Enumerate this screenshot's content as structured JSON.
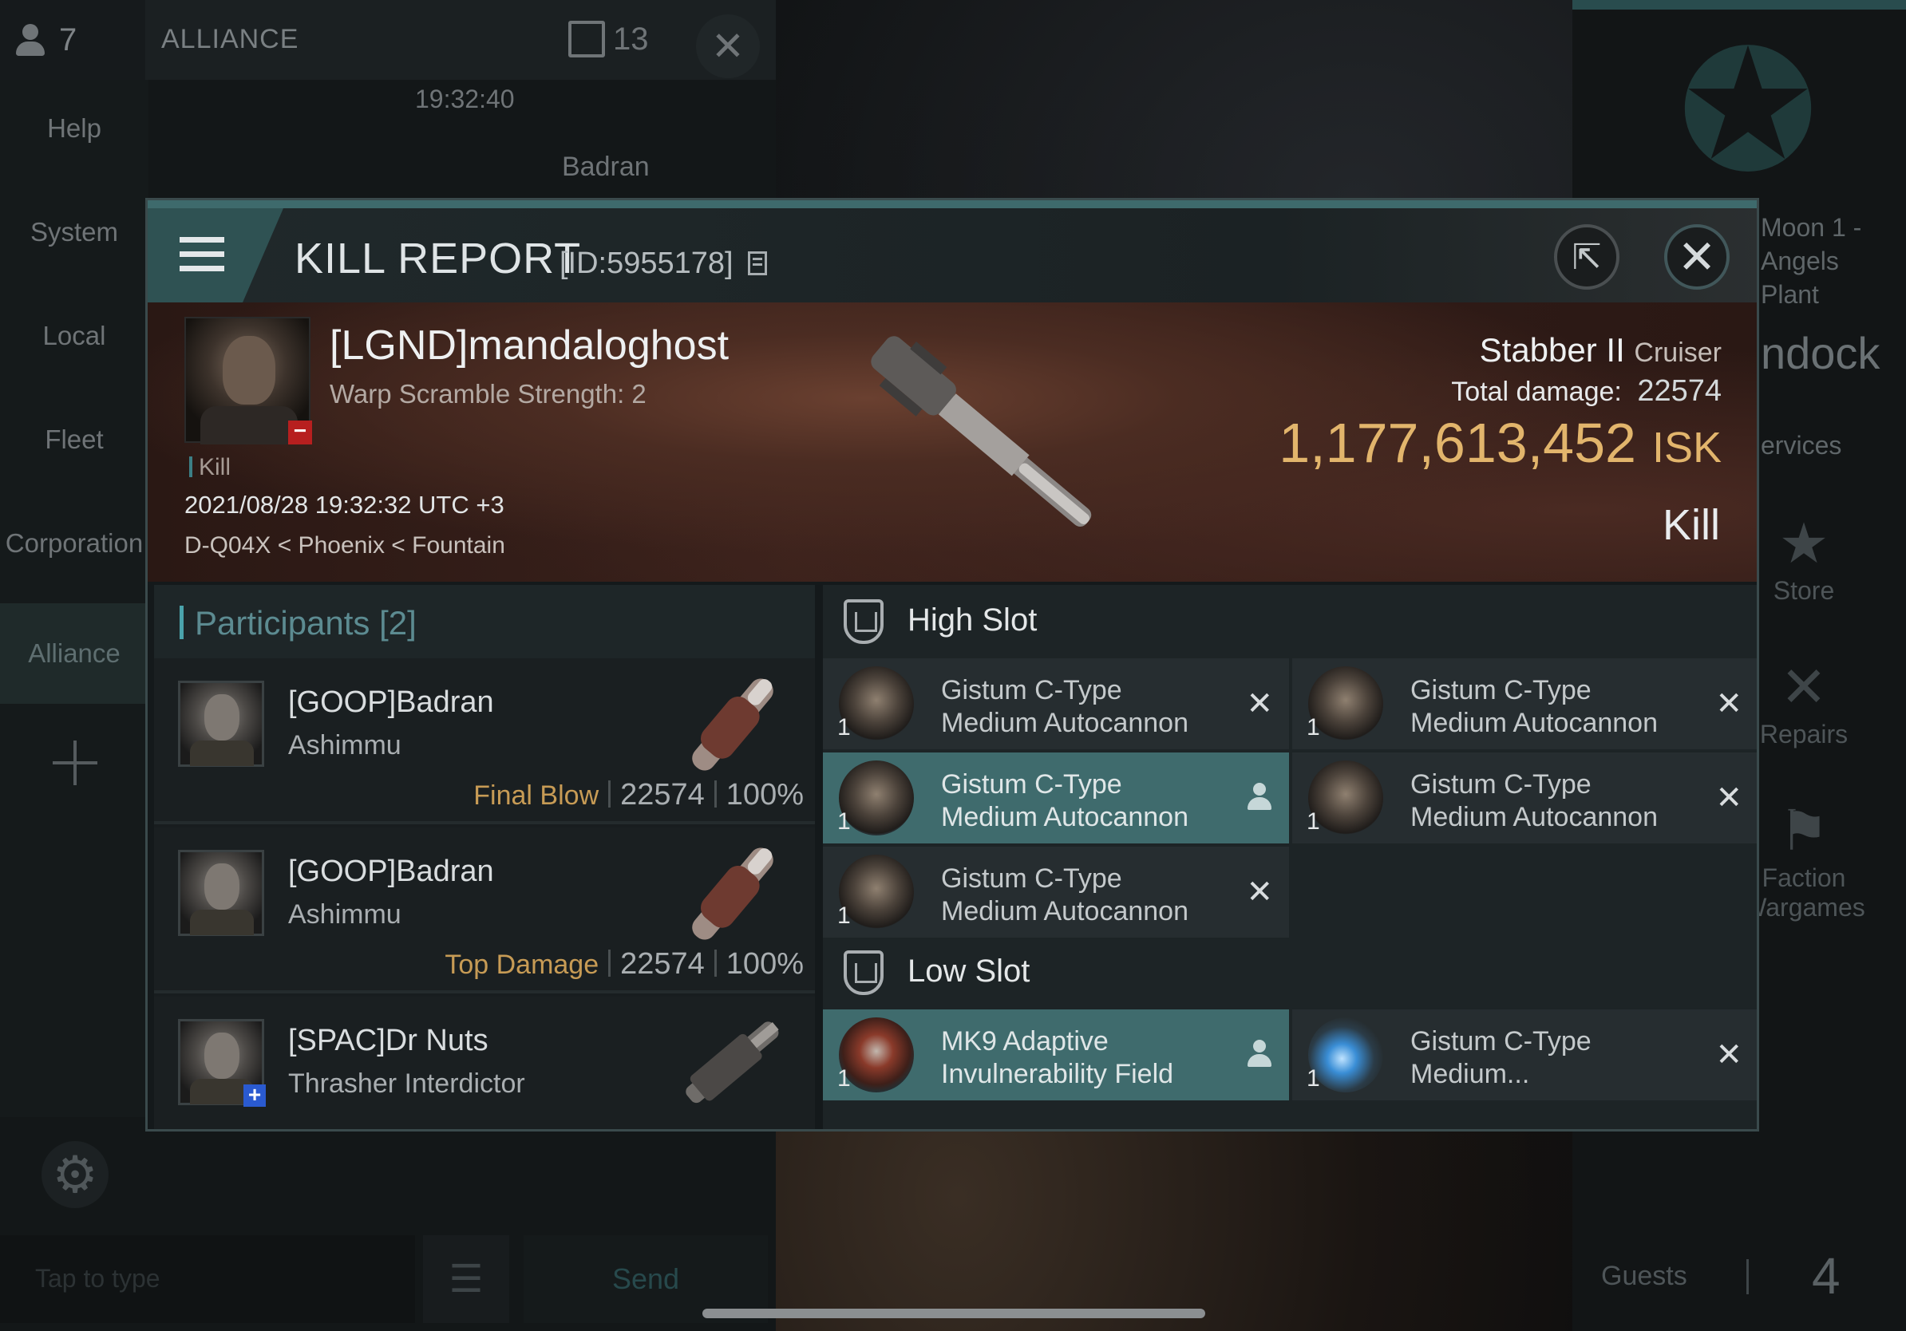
{
  "chat": {
    "member_count": "7",
    "channel": "ALLIANCE",
    "message_count": "13",
    "time": "19:32:40",
    "sender": "Badran",
    "channels": [
      "Help",
      "System",
      "Local",
      "Fleet",
      "Corporation",
      "Alliance"
    ],
    "input_placeholder": "Tap to type",
    "send_label": "Send"
  },
  "station": {
    "name_lines": [
      "Moon 1 -",
      "Angels",
      "Plant"
    ],
    "undock": "ndock",
    "services": "ervices",
    "items": [
      {
        "label": "Store",
        "icon": "nes-icon"
      },
      {
        "label": "Repairs",
        "icon": "wrench-icon"
      },
      {
        "label": "Faction Wargames",
        "icon": "flags-icon"
      }
    ],
    "guests_label": "Guests",
    "guests_count": "4"
  },
  "report": {
    "title": "KILL REPORT",
    "id": "[ID:5955178]",
    "victim": {
      "name": "[LGND]mandaloghost",
      "subtitle": "Warp Scramble Strength: 2",
      "tag": "Kill",
      "datetime": "2021/08/28 19:32:32 UTC +3",
      "location": "D-Q04X < Phoenix < Fountain"
    },
    "ship": "Stabber II",
    "ship_class": "Cruiser",
    "total_damage_label": "Total damage:",
    "total_damage": "22574",
    "isk_value": "1,177,613,452",
    "isk_unit": "ISK",
    "result": "Kill"
  },
  "participants": {
    "title": "Participants [2]",
    "rows": [
      {
        "name": "[GOOP]Badran",
        "ship": "Ashimmu",
        "tag": "Final Blow",
        "damage": "22574",
        "percent": "100%"
      },
      {
        "name": "[GOOP]Badran",
        "ship": "Ashimmu",
        "tag": "Top Damage",
        "damage": "22574",
        "percent": "100%"
      },
      {
        "name": "[SPAC]Dr Nuts",
        "ship": "Thrasher Interdictor"
      }
    ]
  },
  "fitting": {
    "high_slot": "High Slot",
    "low_slot": "Low Slot",
    "high_modules": [
      {
        "name_1": "Gistum C-Type",
        "name_2": "Medium Autocannon",
        "qty": "1",
        "state": "destroyed"
      },
      {
        "name_1": "Gistum C-Type",
        "name_2": "Medium Autocannon",
        "qty": "1",
        "state": "destroyed"
      },
      {
        "name_1": "Gistum C-Type",
        "name_2": "Medium Autocannon",
        "qty": "1",
        "state": "dropped"
      },
      {
        "name_1": "Gistum C-Type",
        "name_2": "Medium Autocannon",
        "qty": "1",
        "state": "destroyed"
      },
      {
        "name_1": "Gistum C-Type",
        "name_2": "Medium Autocannon",
        "qty": "1",
        "state": "destroyed"
      }
    ],
    "low_modules": [
      {
        "name_1": "MK9 Adaptive",
        "name_2": "Invulnerability Field",
        "qty": "1",
        "state": "dropped"
      },
      {
        "name_1": "Gistum C-Type",
        "name_2": "Medium...",
        "qty": "1",
        "state": "destroyed"
      }
    ],
    "destroyed_glyph": "✕"
  }
}
